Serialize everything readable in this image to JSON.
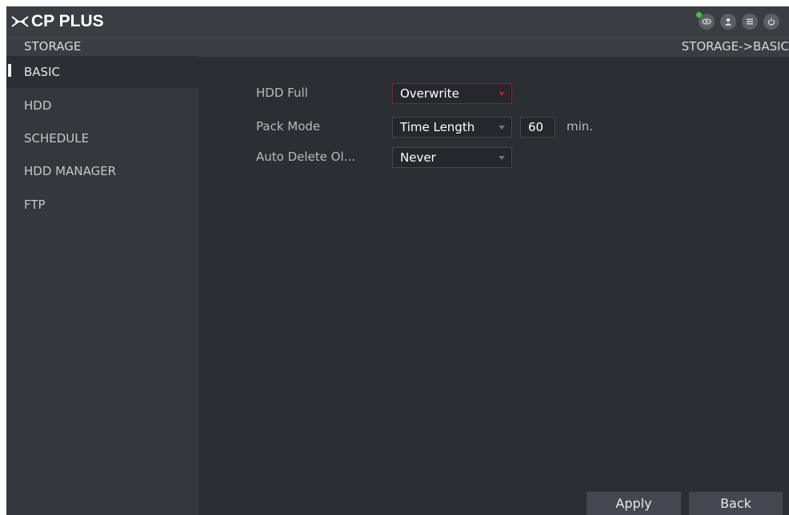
{
  "app": {
    "brand": "CP PLUS"
  },
  "header": {
    "section": "STORAGE",
    "breadcrumb": "STORAGE->BASIC"
  },
  "top_icons": [
    "live-view-icon",
    "user-icon",
    "menu-icon",
    "power-icon"
  ],
  "sidebar": {
    "items": [
      {
        "label": "BASIC",
        "active": true
      },
      {
        "label": "HDD"
      },
      {
        "label": "SCHEDULE"
      },
      {
        "label": "HDD MANAGER"
      },
      {
        "label": "FTP"
      }
    ]
  },
  "form": {
    "hdd_full": {
      "label": "HDD Full",
      "value": "Overwrite"
    },
    "pack_mode": {
      "label": "Pack Mode",
      "value": "Time Length",
      "length": "60",
      "unit": "min."
    },
    "auto_delete": {
      "label": "Auto Delete Ol...",
      "value": "Never"
    }
  },
  "buttons": {
    "apply": "Apply",
    "back": "Back"
  },
  "colors": {
    "background": "#2b2e33",
    "highlight_border": "#9b1a1a",
    "live_indicator": "#3ec43a"
  }
}
